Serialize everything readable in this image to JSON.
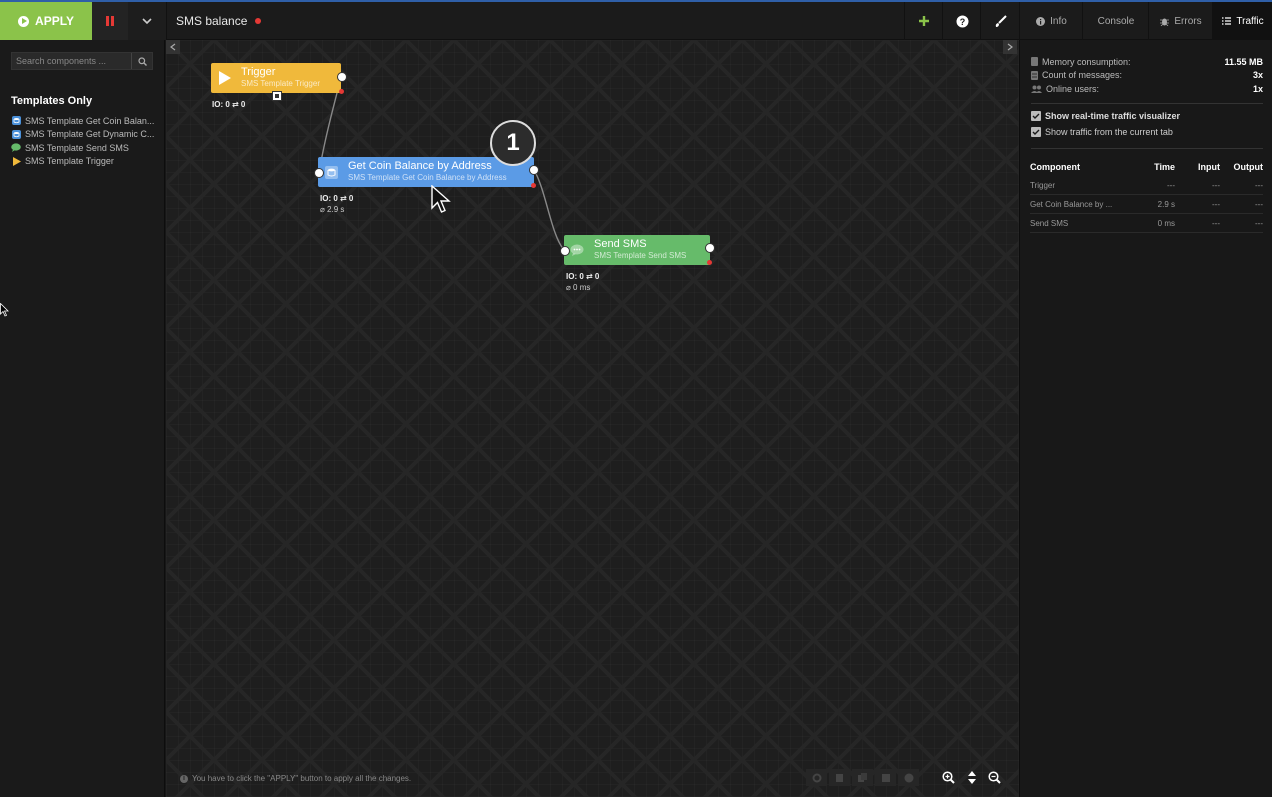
{
  "toolbar": {
    "apply_label": "APPLY",
    "flow_title": "SMS balance"
  },
  "tabs": [
    {
      "label": "Info",
      "icon": "info-icon"
    },
    {
      "label": "Console",
      "icon": ""
    },
    {
      "label": "Errors",
      "icon": "bug-icon"
    },
    {
      "label": "Traffic",
      "icon": "list-icon",
      "active": true
    }
  ],
  "sidebar": {
    "search_placeholder": "Search components ...",
    "heading": "Templates Only",
    "items": [
      {
        "label": "SMS Template Get Coin Balan...",
        "icon": "database-icon",
        "color": "#4a90d9"
      },
      {
        "label": "SMS Template Get Dynamic C...",
        "icon": "database-icon",
        "color": "#4a90d9"
      },
      {
        "label": "SMS Template Send SMS",
        "icon": "comment-icon",
        "color": "#66bb6a"
      },
      {
        "label": "SMS Template Trigger",
        "icon": "play-icon",
        "color": "#f0b93b"
      }
    ]
  },
  "nodes": {
    "trigger": {
      "title": "Trigger",
      "subtitle": "SMS Template Trigger",
      "io": "IO: 0 ⇄ 0",
      "color": "#f0b93b"
    },
    "coin": {
      "title": "Get Coin Balance by Address",
      "subtitle": "SMS Template Get Coin Balance by Address",
      "io": "IO: 0 ⇄ 0",
      "time": "⌀ 2.9 s",
      "color": "#5b9be6"
    },
    "sms": {
      "title": "Send SMS",
      "subtitle": "SMS Template Send SMS",
      "io": "IO: 0 ⇄ 0",
      "time": "⌀ 0 ms",
      "color": "#66bb6a"
    }
  },
  "badge": "1",
  "hint_text": "You have to click the \"APPLY\" button to apply all the changes.",
  "traffic": {
    "stats": [
      {
        "label": "Memory consumption:",
        "value": "11.55 MB",
        "icon": "memory-icon"
      },
      {
        "label": "Count of messages:",
        "value": "3x",
        "icon": "database-icon"
      },
      {
        "label": "Online users:",
        "value": "1x",
        "icon": "users-icon"
      }
    ],
    "checks": [
      {
        "label": "Show real-time traffic visualizer",
        "checked": true
      },
      {
        "label": "Show traffic from the current tab",
        "checked": true
      }
    ],
    "columns": [
      "Component",
      "Time",
      "Input",
      "Output"
    ],
    "rows": [
      [
        "Trigger",
        "---",
        "---",
        "---"
      ],
      [
        "Get Coin Balance by ...",
        "2.9 s",
        "---",
        "---"
      ],
      [
        "Send SMS",
        "0 ms",
        "---",
        "---"
      ]
    ]
  }
}
